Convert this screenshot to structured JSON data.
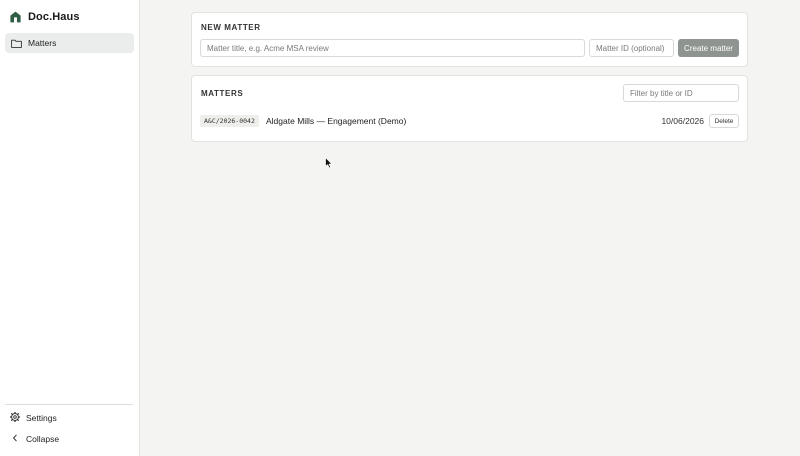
{
  "app": {
    "name": "Doc.Haus"
  },
  "sidebar": {
    "items": [
      {
        "label": "Matters",
        "icon": "folder-icon",
        "active": true
      }
    ],
    "settings_label": "Settings",
    "collapse_label": "Collapse"
  },
  "new_matter": {
    "heading": "NEW MATTER",
    "title_placeholder": "Matter title, e.g. Acme MSA review",
    "id_placeholder": "Matter ID (optional)",
    "create_label": "Create matter"
  },
  "matters": {
    "heading": "MATTERS",
    "filter_placeholder": "Filter by title or ID",
    "rows": [
      {
        "id": "A&C/2026-0042",
        "title": "Aldgate Mills — Engagement (Demo)",
        "date": "10/06/2026",
        "delete_label": "Delete"
      }
    ]
  },
  "colors": {
    "brand_green": "#2f5d45",
    "active_nav_bg": "#eaedeb",
    "create_button_bg": "#8e9490",
    "page_bg": "#f4f4f2"
  }
}
